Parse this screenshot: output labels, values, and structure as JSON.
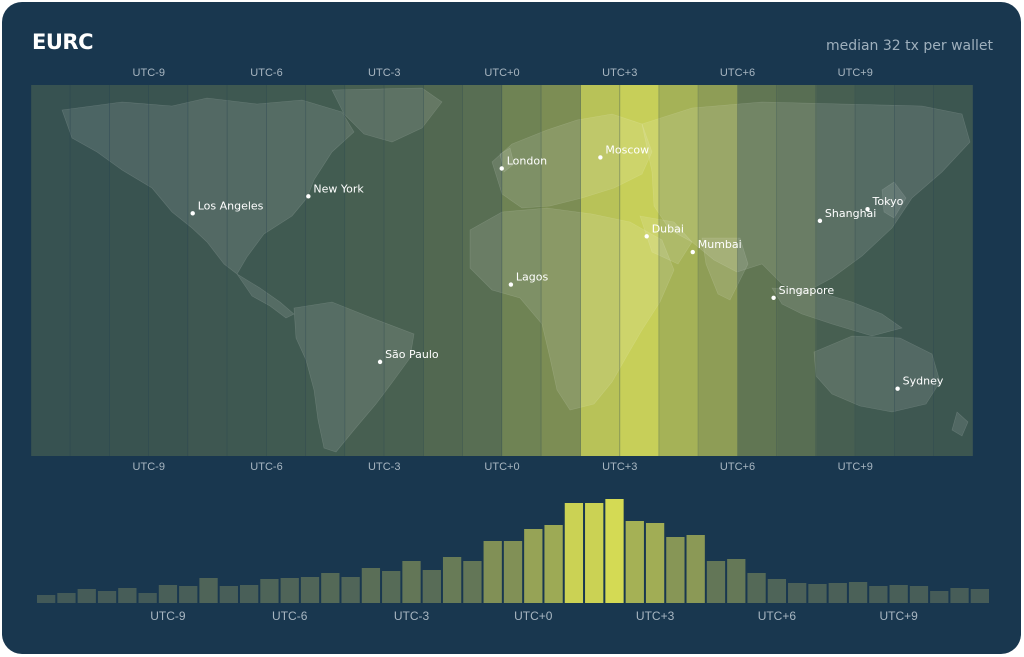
{
  "header": {
    "title": "EURC",
    "subtitle": "median 32 tx per wallet"
  },
  "colors": {
    "background": "#19374f",
    "map_base": "#2b4750",
    "highlight_max": "#d8de5a",
    "bar_low": "#405758",
    "bar_high": "#d4da54"
  },
  "chart_data": [
    {
      "type": "heatmap",
      "title": "",
      "description_axis": "UTC offset",
      "x_tick_labels": [
        "UTC-9",
        "UTC-6",
        "UTC-3",
        "UTC+0",
        "UTC+3",
        "UTC+6",
        "UTC+9"
      ],
      "x_tick_values": [
        -9,
        -6,
        -3,
        0,
        3,
        6,
        9
      ],
      "xlim": [
        -12,
        12
      ],
      "band_width_hours": 1,
      "band_intensity": [
        0.04,
        0.04,
        0.05,
        0.06,
        0.08,
        0.09,
        0.1,
        0.12,
        0.14,
        0.16,
        0.22,
        0.26,
        0.42,
        0.5,
        0.9,
        1.0,
        0.78,
        0.62,
        0.32,
        0.26,
        0.14,
        0.1,
        0.08,
        0.07
      ],
      "cities": [
        {
          "name": "Los Angeles",
          "lon": -118.2,
          "lat": 34.1
        },
        {
          "name": "New York",
          "lon": -74.0,
          "lat": 40.7
        },
        {
          "name": "São Paulo",
          "lon": -46.6,
          "lat": -23.5
        },
        {
          "name": "London",
          "lon": -0.1,
          "lat": 51.5
        },
        {
          "name": "Lagos",
          "lon": 3.4,
          "lat": 6.5
        },
        {
          "name": "Moscow",
          "lon": 37.6,
          "lat": 55.8
        },
        {
          "name": "Dubai",
          "lon": 55.3,
          "lat": 25.2
        },
        {
          "name": "Mumbai",
          "lon": 72.9,
          "lat": 19.1
        },
        {
          "name": "Singapore",
          "lon": 103.8,
          "lat": 1.35
        },
        {
          "name": "Shanghai",
          "lon": 121.5,
          "lat": 31.2
        },
        {
          "name": "Tokyo",
          "lon": 139.7,
          "lat": 35.7
        },
        {
          "name": "Sydney",
          "lon": 151.2,
          "lat": -33.9
        }
      ]
    },
    {
      "type": "bar",
      "title": "",
      "xlabel": "",
      "ylabel": "",
      "x_tick_labels": [
        "UTC-9",
        "UTC-6",
        "UTC-3",
        "UTC+0",
        "UTC+3",
        "UTC+6",
        "UTC+9"
      ],
      "x_tick_values": [
        -9,
        -6,
        -3,
        0,
        3,
        6,
        9
      ],
      "x_start": -12,
      "x_step": 0.5,
      "ylim": [
        0,
        110
      ],
      "values": [
        8,
        10,
        14,
        12,
        15,
        10,
        18,
        17,
        25,
        17,
        18,
        24,
        25,
        26,
        30,
        26,
        35,
        32,
        42,
        33,
        46,
        42,
        62,
        62,
        74,
        78,
        100,
        100,
        104,
        82,
        80,
        66,
        68,
        42,
        44,
        30,
        24,
        20,
        19,
        20,
        21,
        17,
        18,
        17,
        12,
        15,
        14
      ]
    }
  ]
}
